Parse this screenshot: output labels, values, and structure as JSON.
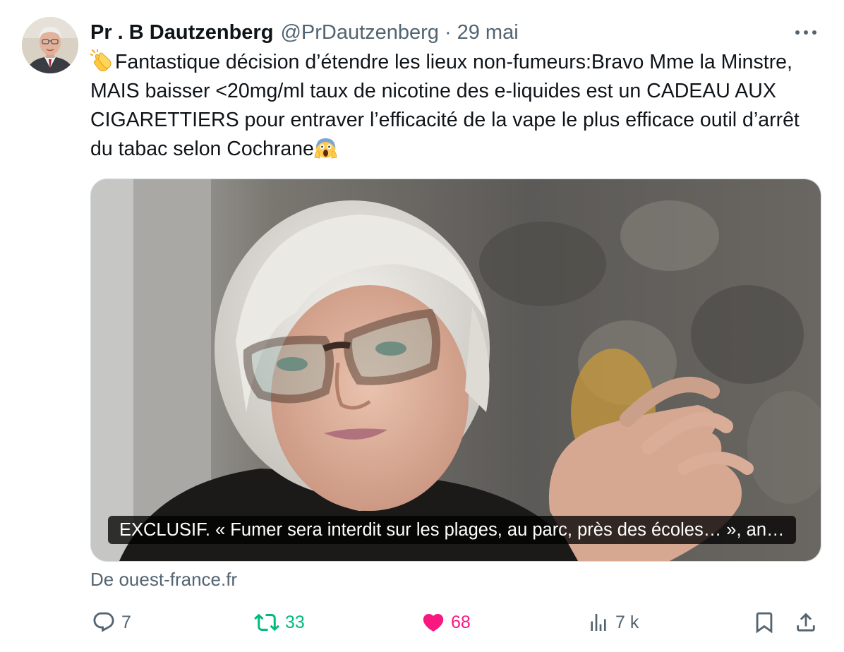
{
  "tweet": {
    "display_name": "Pr . B Dautzenberg",
    "handle": "@PrDautzenberg",
    "separator": "·",
    "date": "29 mai",
    "text_part1": "Fantastique décision d’étendre les lieux non-fumeurs:Bravo Mme la Minstre, MAIS baisser <20mg/ml taux de nicotine des e-liquides est un CADEAU AUX CIGARETTIERS pour entraver l’efficacité de la vape le plus efficace outil d’arrêt du tabac selon Cochrane",
    "emoji_start": "clapping-hands-emoji",
    "emoji_end": "face-screaming-in-fear-emoji"
  },
  "card": {
    "caption": "EXCLUSIF. « Fumer sera interdit sur les plages, au parc, près des écoles… », an…",
    "source": "De ouest-france.fr"
  },
  "actions": {
    "reply_count": "7",
    "retweet_count": "33",
    "like_count": "68",
    "views_count": "7 k",
    "reply_icon": "speech-bubble-icon",
    "retweet_icon": "retweet-arrows-icon",
    "like_icon": "heart-icon",
    "views_icon": "bar-chart-icon",
    "bookmark_icon": "bookmark-icon",
    "share_icon": "share-upload-icon"
  },
  "colors": {
    "text": "#0f1419",
    "secondary": "#536471",
    "retweet_green": "#00ba7c",
    "like_pink": "#f91880",
    "border": "#cfd9de"
  }
}
